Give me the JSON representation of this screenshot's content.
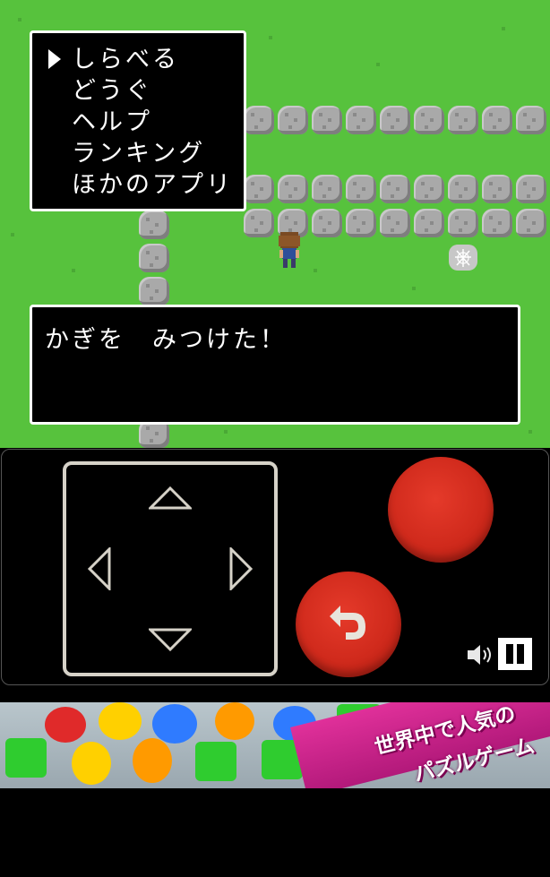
{
  "menu": {
    "items": [
      "しらべる",
      "どうぐ",
      "ヘルプ",
      "ランキング",
      "ほかのアプリ"
    ],
    "selected_index": 0
  },
  "dialog": {
    "text": "かぎを　みつけた！"
  },
  "controller": {
    "dpad_icons": [
      "arrow-up-icon",
      "arrow-left-icon",
      "arrow-right-icon",
      "arrow-down-icon"
    ],
    "action_button_color": "#d02a1c",
    "back_icon": "undo-arrow-icon"
  },
  "ad": {
    "text_line_1": "世界中で人気の",
    "text_line_2": "パズルゲーム"
  },
  "colors": {
    "grass": "#57c23d",
    "rock": "#a9a9a9",
    "window_border": "#ffffff"
  }
}
